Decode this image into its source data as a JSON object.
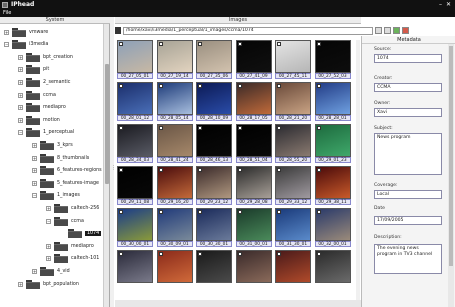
{
  "window": {
    "title": "IPhead"
  },
  "menu": {
    "file": "File"
  },
  "panels": {
    "system": "System",
    "images": "Images",
    "metadata": "Metadata"
  },
  "tree": {
    "items": [
      {
        "label": "vmware",
        "depth": 0,
        "expanded": false,
        "selected": false
      },
      {
        "label": "i3media",
        "depth": 0,
        "expanded": true,
        "selected": false
      },
      {
        "label": "bpt_creation",
        "depth": 1,
        "expanded": false,
        "selected": false
      },
      {
        "label": "pit",
        "depth": 1,
        "expanded": false,
        "selected": false
      },
      {
        "label": "2_semantic",
        "depth": 1,
        "expanded": false,
        "selected": false
      },
      {
        "label": "ccma",
        "depth": 1,
        "expanded": false,
        "selected": false
      },
      {
        "label": "mediapro",
        "depth": 1,
        "expanded": false,
        "selected": false
      },
      {
        "label": "motion",
        "depth": 1,
        "expanded": false,
        "selected": false
      },
      {
        "label": "1_perceptual",
        "depth": 1,
        "expanded": true,
        "selected": false
      },
      {
        "label": "3_kprs",
        "depth": 2,
        "expanded": false,
        "selected": false
      },
      {
        "label": "8_thumbnails",
        "depth": 2,
        "expanded": false,
        "selected": false
      },
      {
        "label": "6_features-regions",
        "depth": 2,
        "expanded": false,
        "selected": false
      },
      {
        "label": "5_features-image",
        "depth": 2,
        "expanded": false,
        "selected": false
      },
      {
        "label": "1_images",
        "depth": 2,
        "expanded": true,
        "selected": false
      },
      {
        "label": "caltech-256",
        "depth": 3,
        "expanded": false,
        "selected": false
      },
      {
        "label": "ccma",
        "depth": 3,
        "expanded": true,
        "selected": false
      },
      {
        "label": "1074",
        "depth": 4,
        "expanded": false,
        "selected": true
      },
      {
        "label": "mediapro",
        "depth": 3,
        "expanded": false,
        "selected": false
      },
      {
        "label": "caltech-101",
        "depth": 3,
        "expanded": false,
        "selected": false
      },
      {
        "label": "4_vid",
        "depth": 2,
        "expanded": false,
        "selected": false
      },
      {
        "label": "bpt_population",
        "depth": 1,
        "expanded": false,
        "selected": false
      }
    ]
  },
  "path": {
    "value": "/home/xavi/i3media/1_perceptual/1_images/ccma/1074"
  },
  "thumbnails": [
    {
      "label": "00_27_05_01",
      "colors": [
        "#8da0b8",
        "#c7b8a4"
      ]
    },
    {
      "label": "00_27_19_14",
      "colors": [
        "#a7a396",
        "#e2d3bf"
      ]
    },
    {
      "label": "00_27_35_06",
      "colors": [
        "#9a8f80",
        "#d2c2ae"
      ]
    },
    {
      "label": "00_27_41_09",
      "colors": [
        "#050505",
        "#101010"
      ]
    },
    {
      "label": "00_27_45_11",
      "colors": [
        "#e4e4e4",
        "#b6b6b6"
      ]
    },
    {
      "label": "00_27_52_03",
      "colors": [
        "#050505",
        "#0d0d0d"
      ]
    },
    {
      "label": "00_28_01_12",
      "colors": [
        "#1b2e6b",
        "#4a6fb8"
      ]
    },
    {
      "label": "00_28_05_14",
      "colors": [
        "#1e3c7a",
        "#a8bede"
      ]
    },
    {
      "label": "00_28_10_09",
      "colors": [
        "#0c1a55",
        "#2a4ca8"
      ]
    },
    {
      "label": "00_28_17_05",
      "colors": [
        "#3b2a28",
        "#c06a3a"
      ]
    },
    {
      "label": "00_28_21_20",
      "colors": [
        "#6a4a3a",
        "#c9a384"
      ]
    },
    {
      "label": "00_28_28_01",
      "colors": [
        "#223c86",
        "#6fa0e0"
      ]
    },
    {
      "label": "00_28_34_03",
      "colors": [
        "#1a1a20",
        "#585a64"
      ]
    },
    {
      "label": "00_28_41_24",
      "colors": [
        "#6a5646",
        "#a6886a"
      ]
    },
    {
      "label": "00_28_46_13",
      "colors": [
        "#000000",
        "#0a0a0a"
      ]
    },
    {
      "label": "00_28_51_04",
      "colors": [
        "#000000",
        "#0a0a0a"
      ]
    },
    {
      "label": "00_28_55_20",
      "colors": [
        "#2a2a30",
        "#8a7a70"
      ]
    },
    {
      "label": "00_29_01_23",
      "colors": [
        "#1d6a3e",
        "#3fa86a"
      ]
    },
    {
      "label": "00_29_11_08",
      "colors": [
        "#000000",
        "#080808"
      ]
    },
    {
      "label": "00_29_16_20",
      "colors": [
        "#4a0c0c",
        "#c46a3a"
      ]
    },
    {
      "label": "00_29_23_12",
      "colors": [
        "#3a2a2a",
        "#b09880"
      ]
    },
    {
      "label": "00_29_28_08",
      "colors": [
        "#2a2a2a",
        "#a8a098"
      ]
    },
    {
      "label": "00_29_33_12",
      "colors": [
        "#3a3a3a",
        "#a09aa0"
      ]
    },
    {
      "label": "00_29_38_11",
      "colors": [
        "#4a0a0a",
        "#c85a2a"
      ]
    },
    {
      "label": "00_30_00_01",
      "colors": [
        "#1a3c8a",
        "#8a9a3a"
      ]
    },
    {
      "label": "00_30_09_01",
      "colors": [
        "#203a7a",
        "#7a8a9a"
      ]
    },
    {
      "label": "00_30_30_01",
      "colors": [
        "#1a2a5a",
        "#6a7a9a"
      ]
    },
    {
      "label": "00_31_00_01",
      "colors": [
        "#1a3a2a",
        "#4a8a5a"
      ]
    },
    {
      "label": "00_31_30_01",
      "colors": [
        "#1a3a7a",
        "#5a8aca"
      ]
    },
    {
      "label": "00_32_00_01",
      "colors": [
        "#2a3a6a",
        "#9a8a7a"
      ]
    },
    {
      "label": "",
      "colors": [
        "#2a2a3a",
        "#7a7a8a"
      ]
    },
    {
      "label": "",
      "colors": [
        "#8a2a1a",
        "#d06a3a"
      ]
    },
    {
      "label": "",
      "colors": [
        "#1a1a1a",
        "#4a4a4a"
      ]
    },
    {
      "label": "",
      "colors": [
        "#3a2a2a",
        "#8a6a5a"
      ]
    },
    {
      "label": "",
      "colors": [
        "#4a1a1a",
        "#b04a2a"
      ]
    },
    {
      "label": "",
      "colors": [
        "#2a2a2a",
        "#6a6a6a"
      ]
    }
  ],
  "metadata": {
    "source_label": "Source:",
    "source": "1074",
    "creator_label": "Creator:",
    "creator": "CCMA",
    "owner_label": "Owner:",
    "owner": "Xavi",
    "subject_label": "Subject:",
    "subject": "News program",
    "coverage_label": "Coverage:",
    "coverage": "Local",
    "date_label": "Date",
    "date": "17/09/2005",
    "description_label": "Description:",
    "description": "The evening news program in TV3 channel"
  }
}
